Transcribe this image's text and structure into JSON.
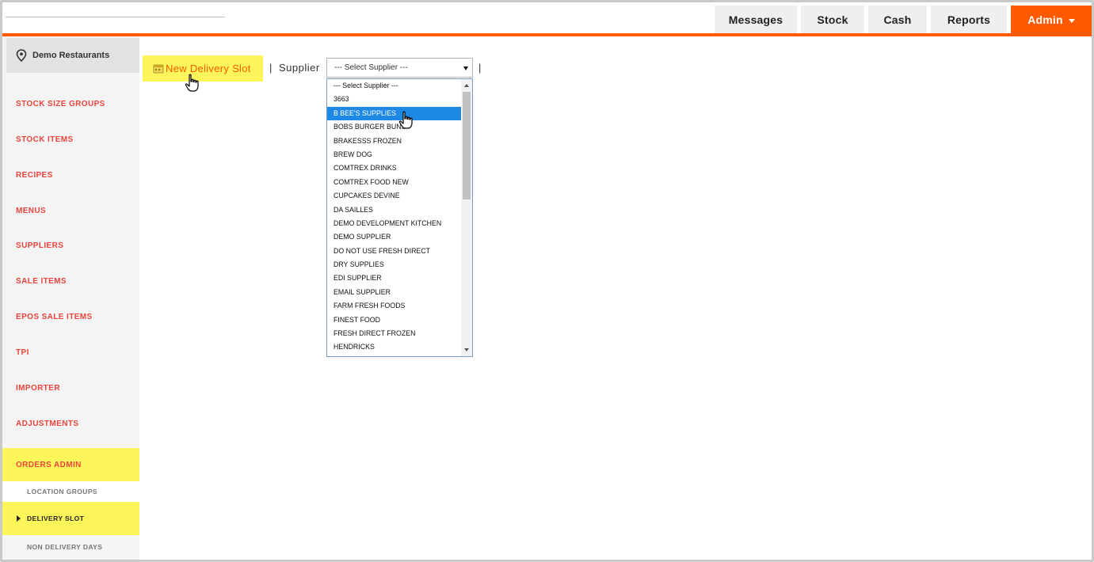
{
  "header": {
    "nav": [
      "Messages",
      "Stock",
      "Cash",
      "Reports"
    ],
    "admin_label": "Admin"
  },
  "sidebar": {
    "location": "Demo Restaurants",
    "items": [
      "STOCK SIZE GROUPS",
      "STOCK ITEMS",
      "RECIPES",
      "MENUS",
      "SUPPLIERS",
      "SALE ITEMS",
      "EPOS SALE ITEMS",
      "TPI",
      "IMPORTER",
      "ADJUSTMENTS",
      "ORDERS ADMIN"
    ],
    "sub_items": [
      "LOCATION GROUPS",
      "DELIVERY SLOT",
      "NON DELIVERY DAYS"
    ]
  },
  "toolbar": {
    "new_slot_label": "New Delivery Slot",
    "separator": "|",
    "supplier_label": "Supplier",
    "select_value": "--- Select Supplier ---"
  },
  "dropdown": {
    "options": [
      "--- Select Supplier ---",
      "3663",
      "B BEE'S SUPPLIES",
      "BOBS BURGER BUNS",
      "BRAKESSS FROZEN",
      "BREW DOG",
      "COMTREX DRINKS",
      "COMTREX FOOD NEW",
      "CUPCAKES DEVINE",
      "DA SAILLES",
      "DEMO DEVELOPMENT KITCHEN",
      "DEMO SUPPLIER",
      "DO NOT USE FRESH DIRECT",
      "DRY SUPPLIES",
      "EDI SUPPLIER",
      "EMAIL SUPPLIER",
      "FARM FRESH FOODS",
      "FINEST FOOD",
      "FRESH DIRECT FROZEN",
      "HENDRICKS"
    ],
    "selected": "B BEE'S SUPPLIES"
  },
  "icons": {
    "location": "map-pin-icon",
    "new_slot": "calendar-add-icon",
    "cursor": "hand-pointer-icon"
  },
  "colors": {
    "accent": "#ff5a00",
    "menu_text": "#e8443c",
    "highlight": "#fdf65a",
    "selected_option": "#1e88e5"
  }
}
